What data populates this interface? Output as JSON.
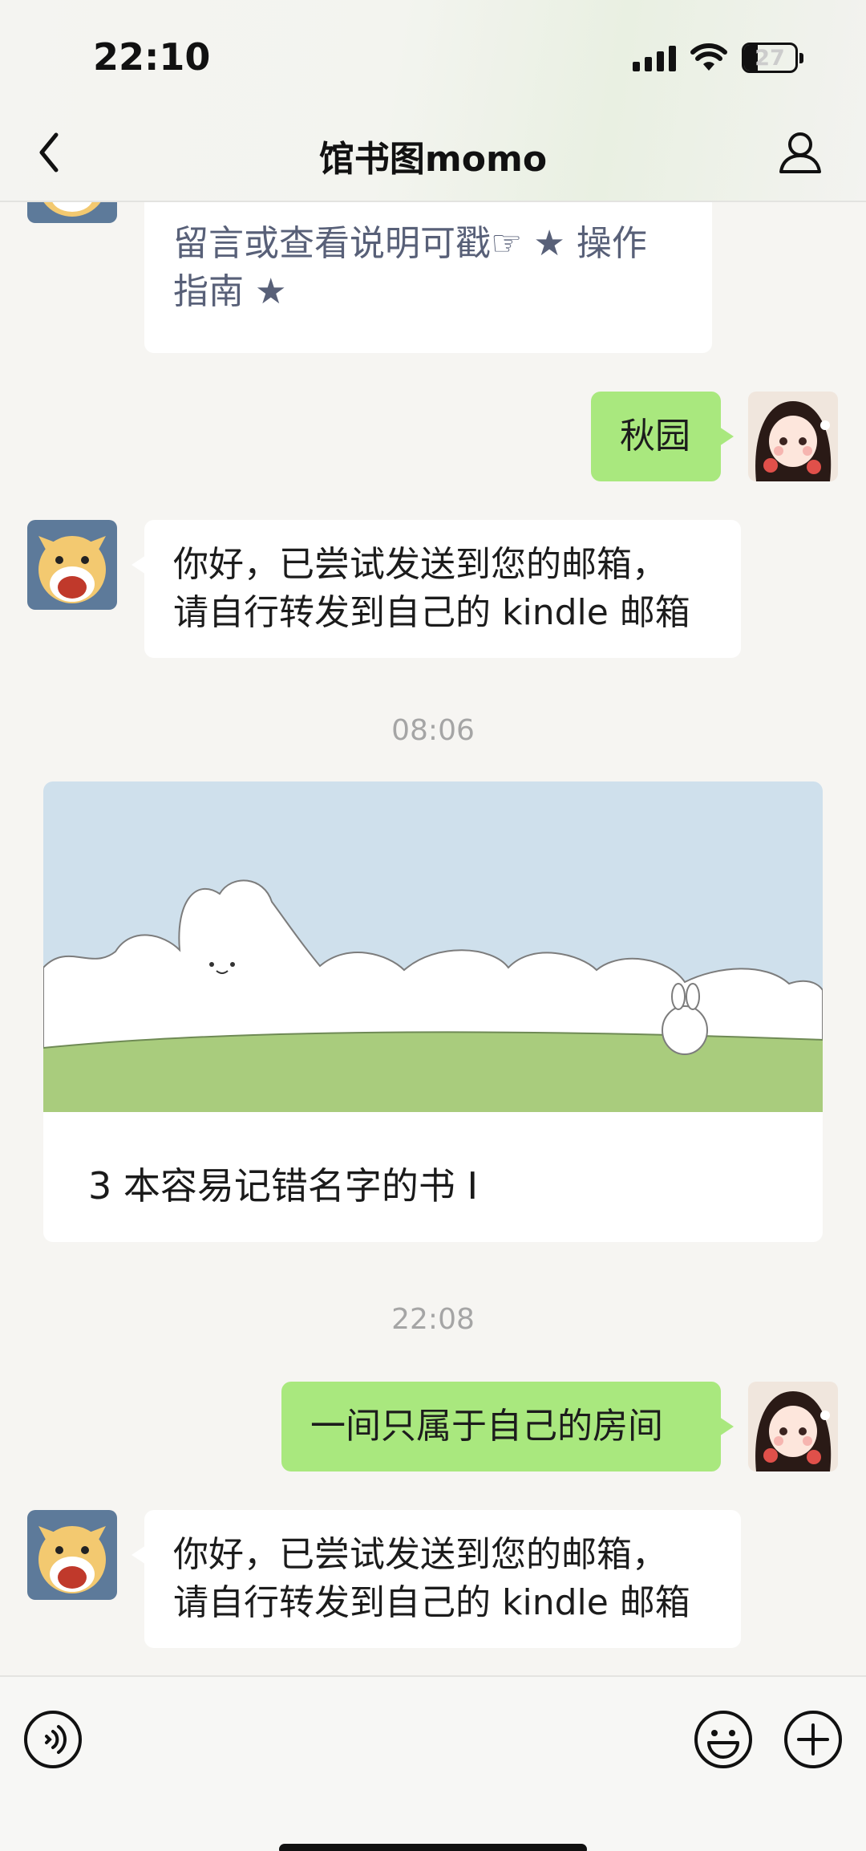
{
  "status_bar": {
    "time": "22:10",
    "battery": "27",
    "icons": [
      "signal-icon",
      "wifi-icon",
      "battery-icon"
    ]
  },
  "nav": {
    "title": "馆书图momo",
    "icons": [
      "back-chevron-icon",
      "user-profile-icon"
    ]
  },
  "messages": {
    "m0": {
      "text_line1": "留言或查看说明可戳☞ ★ 操作",
      "text_line2": "指南 ★"
    },
    "m1": {
      "text": "秋园"
    },
    "m2": {
      "text_line1": "你好，已尝试发送到您的邮箱，",
      "text_line2": "请自行转发到自己的 kindle 邮箱"
    },
    "t1": {
      "text": "08:06"
    },
    "card": {
      "title": "3 本容易记错名字的书 I"
    },
    "t2": {
      "text": "22:08"
    },
    "m3": {
      "text": "一间只属于自己的房间"
    },
    "m4": {
      "text_line1": "你好，已尝试发送到您的邮箱，",
      "text_line2": "请自行转发到自己的 kindle 邮箱"
    }
  },
  "input_bar": {
    "icons": [
      "voice-icon",
      "emoji-icon",
      "plus-icon"
    ]
  },
  "colors": {
    "green_bubble": "#a9e87e",
    "background": "#f6f5f2",
    "timestamp": "#a5a5a5"
  }
}
